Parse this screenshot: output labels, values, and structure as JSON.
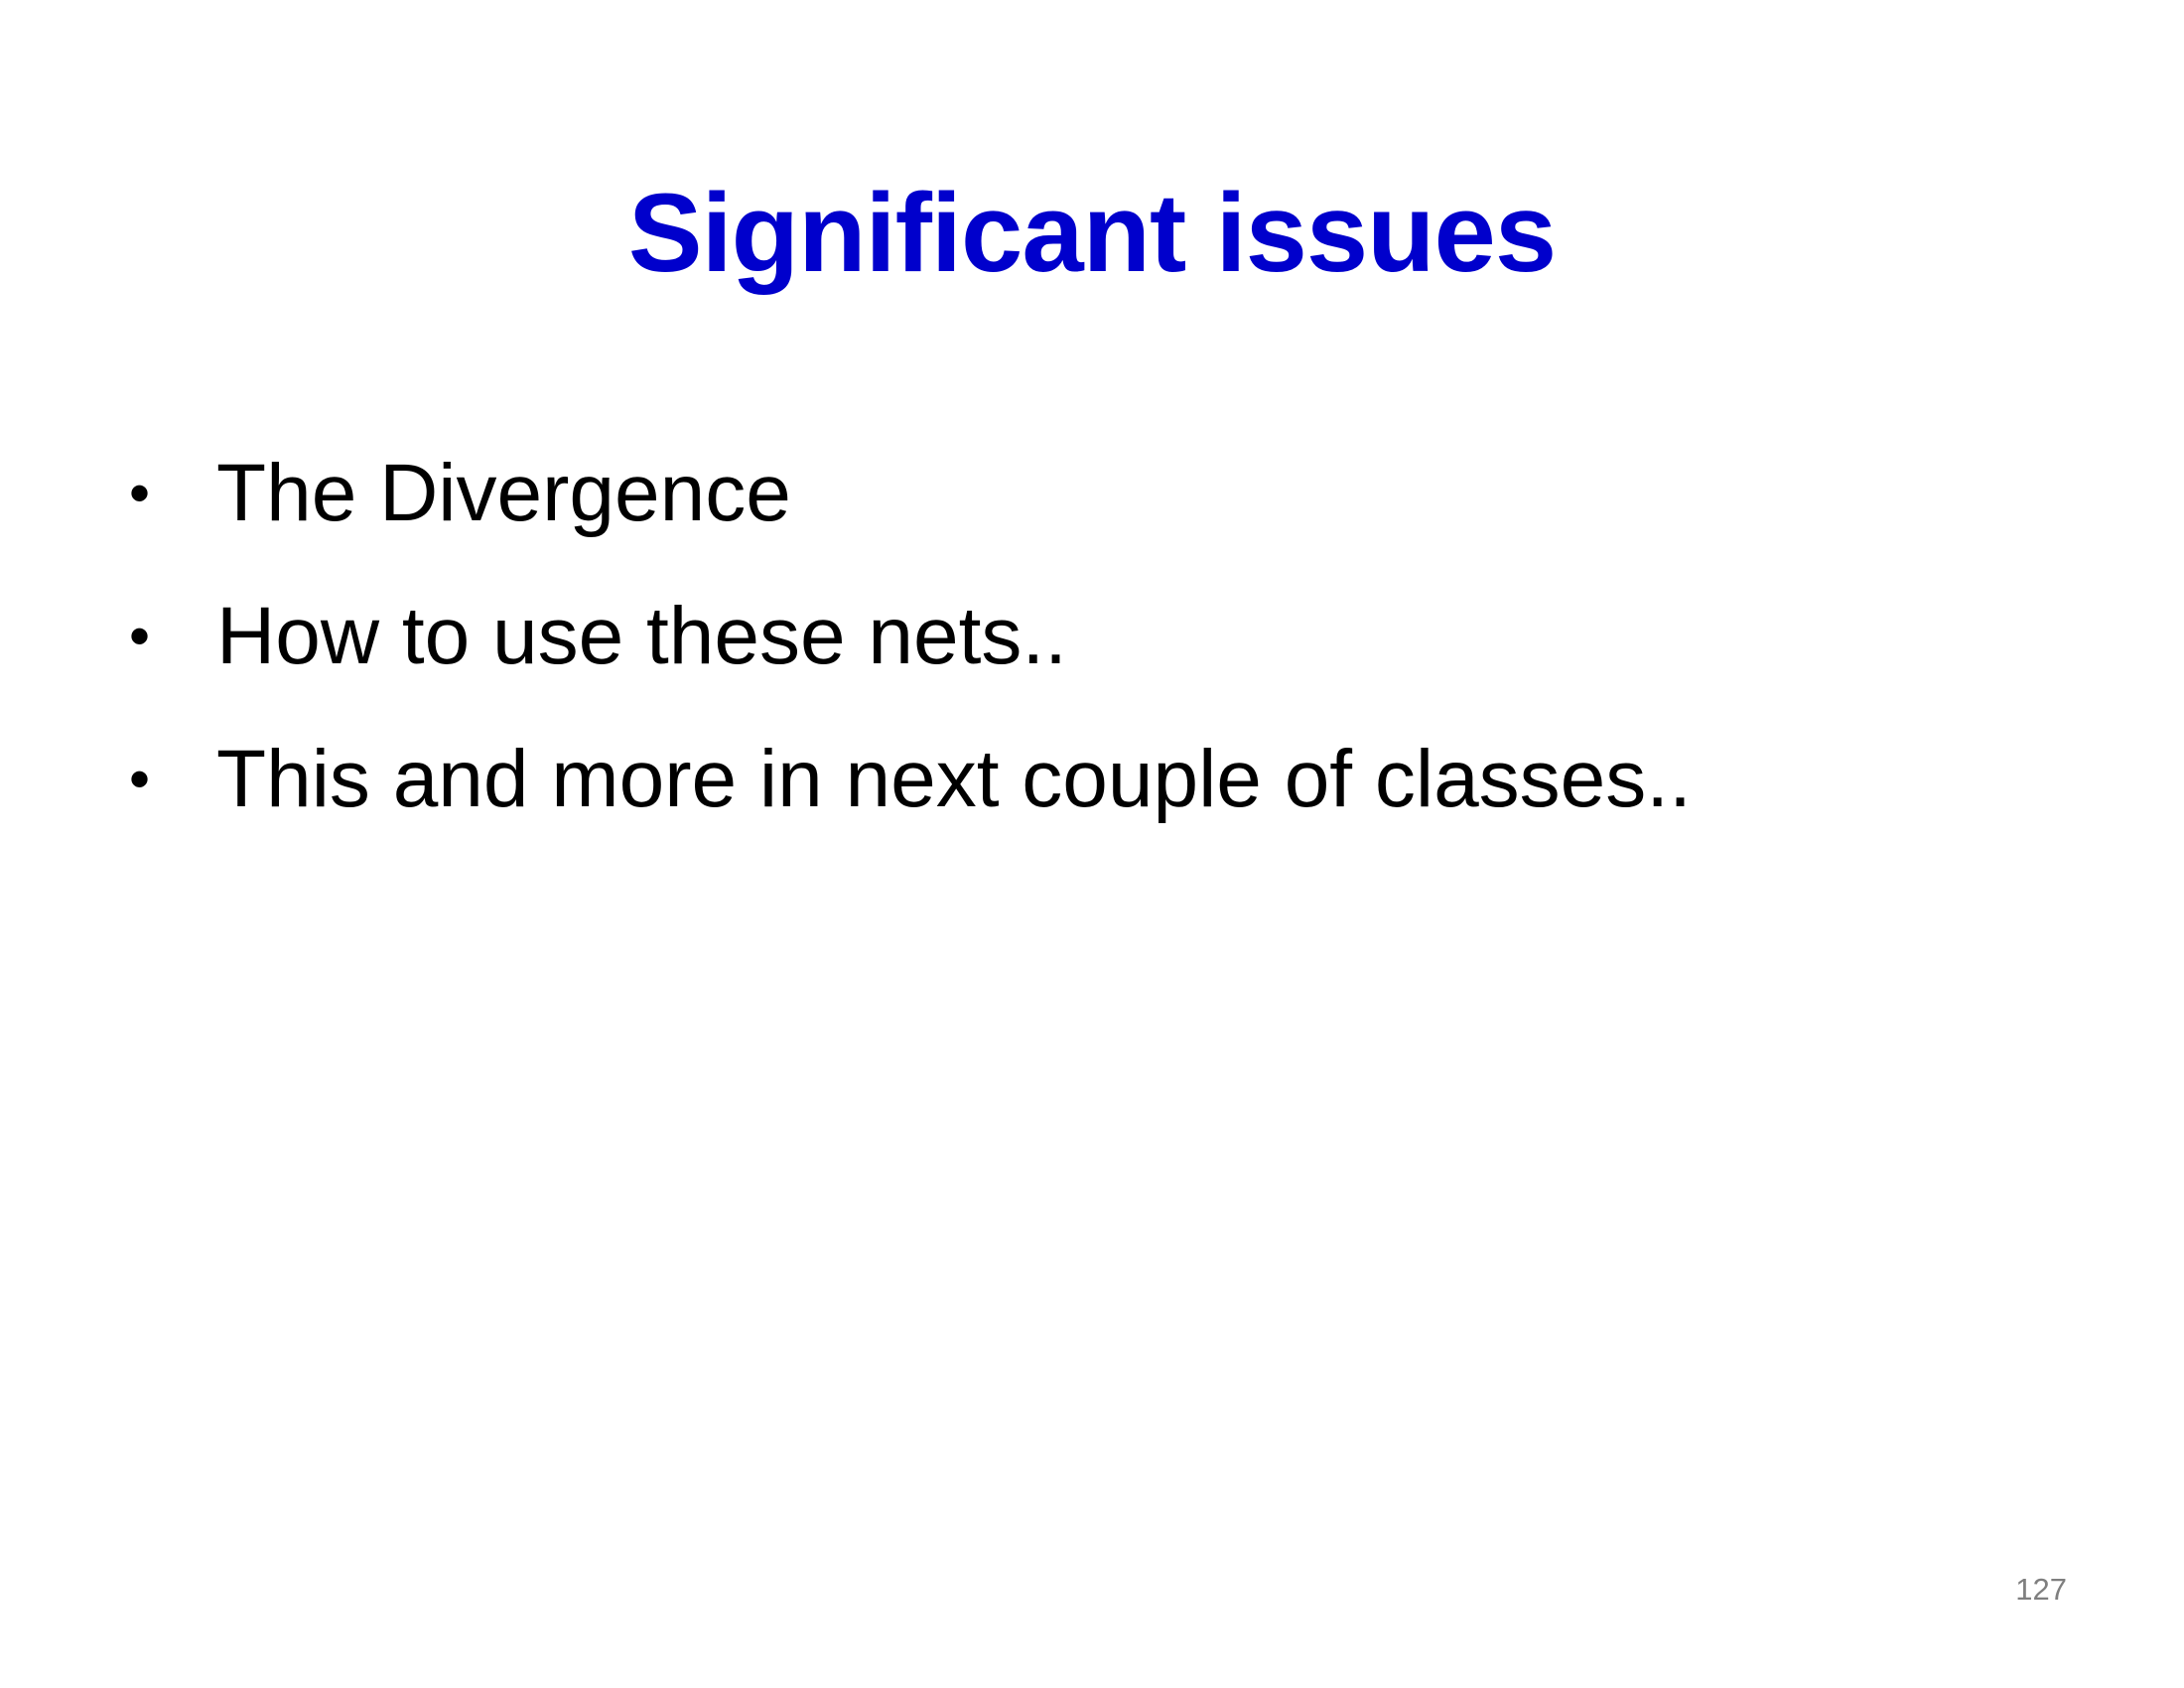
{
  "slide": {
    "title": "Significant issues",
    "title_color": "#0000cc",
    "text_color": "#000000",
    "bullet_glyph": "•",
    "bullets": [
      "The Divergence",
      "How to use these nets..",
      "This and more in next couple of classes.."
    ],
    "page_number": "127"
  }
}
